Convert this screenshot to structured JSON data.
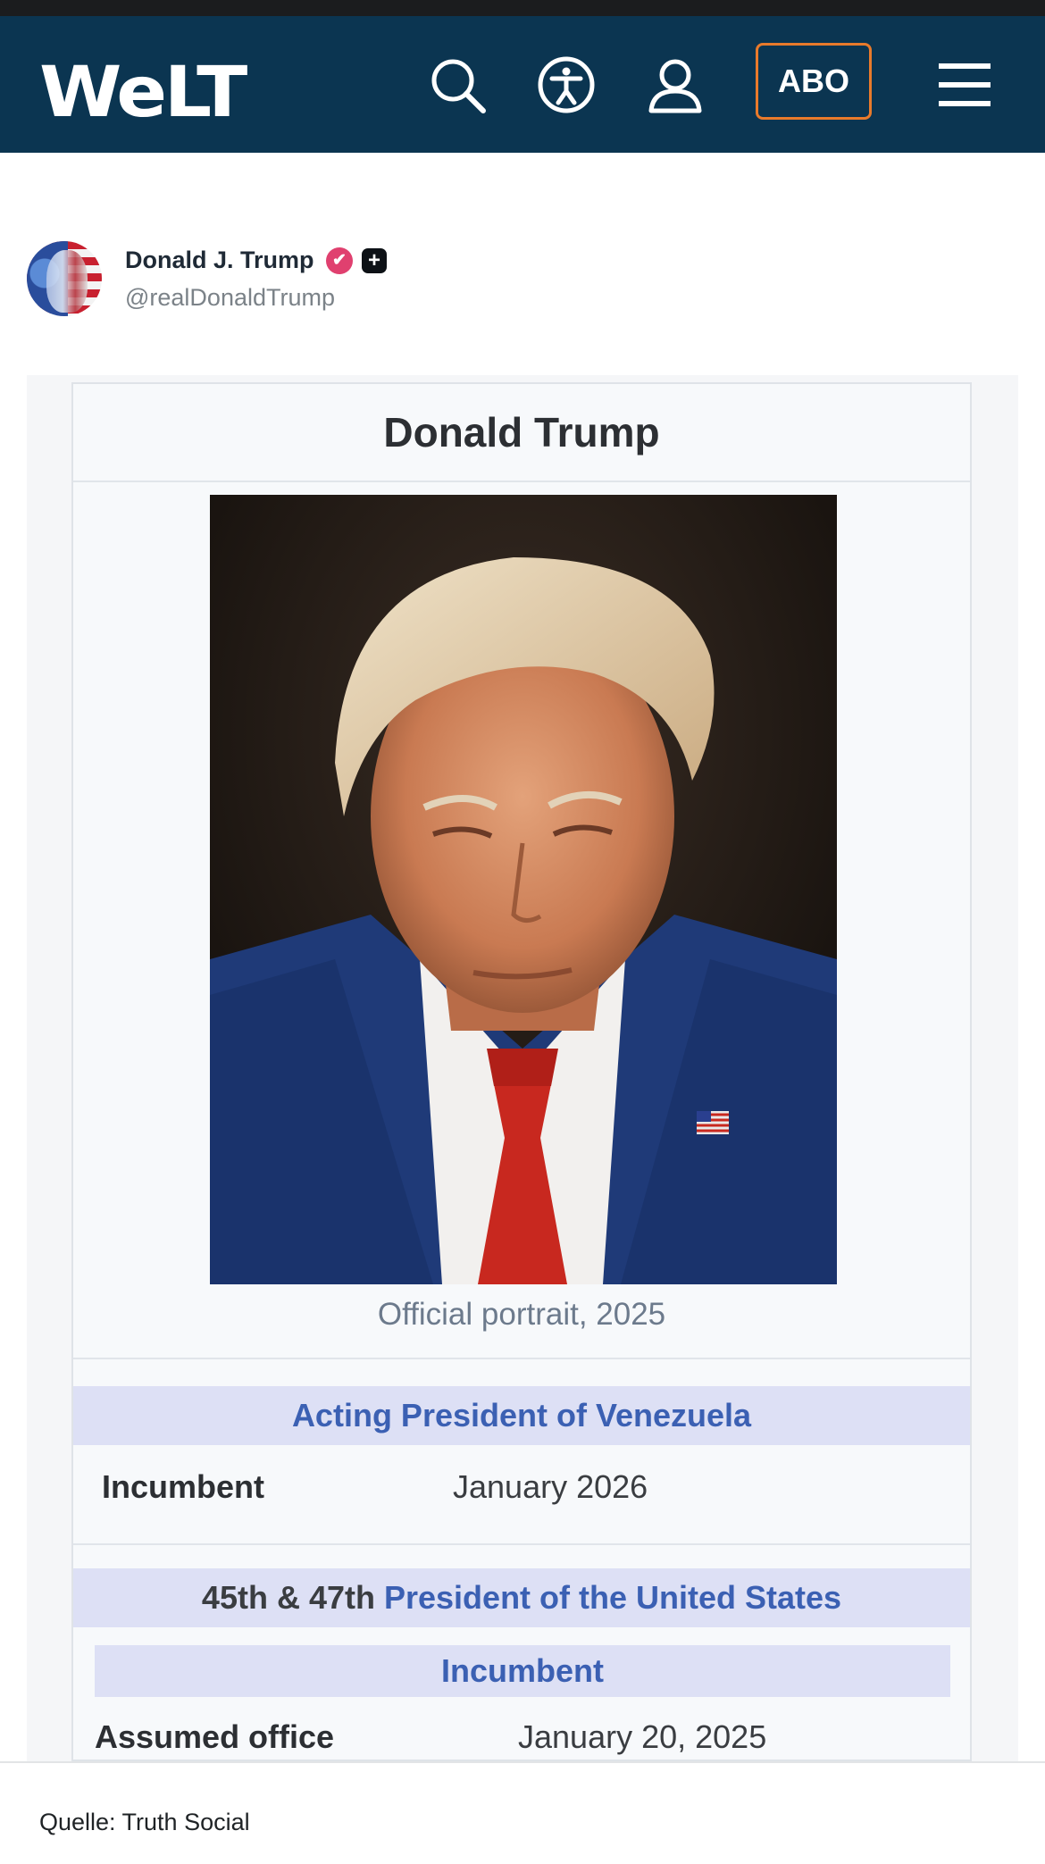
{
  "header": {
    "logo": "WELT",
    "abo_label": "ABO"
  },
  "icons": {
    "search": "search-icon",
    "accessibility": "accessibility-icon",
    "account": "user-icon",
    "menu": "hamburger-menu-icon"
  },
  "post": {
    "name": "Donald J. Trump",
    "handle": "@realDonaldTrump",
    "verified_badge": "✔",
    "plus_badge": "+"
  },
  "infobox": {
    "title": "Donald Trump",
    "caption": "Official portrait, 2025",
    "section1_title": "Acting President of Venezuela",
    "row1_label": "Incumbent",
    "row1_value": "January 2026",
    "section2_prefix": "45th & 47th",
    "section2_title": "President of the United States",
    "subheader": "Incumbent",
    "row2_label": "Assumed office",
    "row2_value": "January 20, 2025"
  },
  "footer": {
    "source": "Quelle: Truth Social"
  },
  "colors": {
    "header_bg": "#0b3551",
    "abo_border": "#e97a2b",
    "wiki_blue": "#3b60b3",
    "band_bg": "#dde0f5"
  }
}
